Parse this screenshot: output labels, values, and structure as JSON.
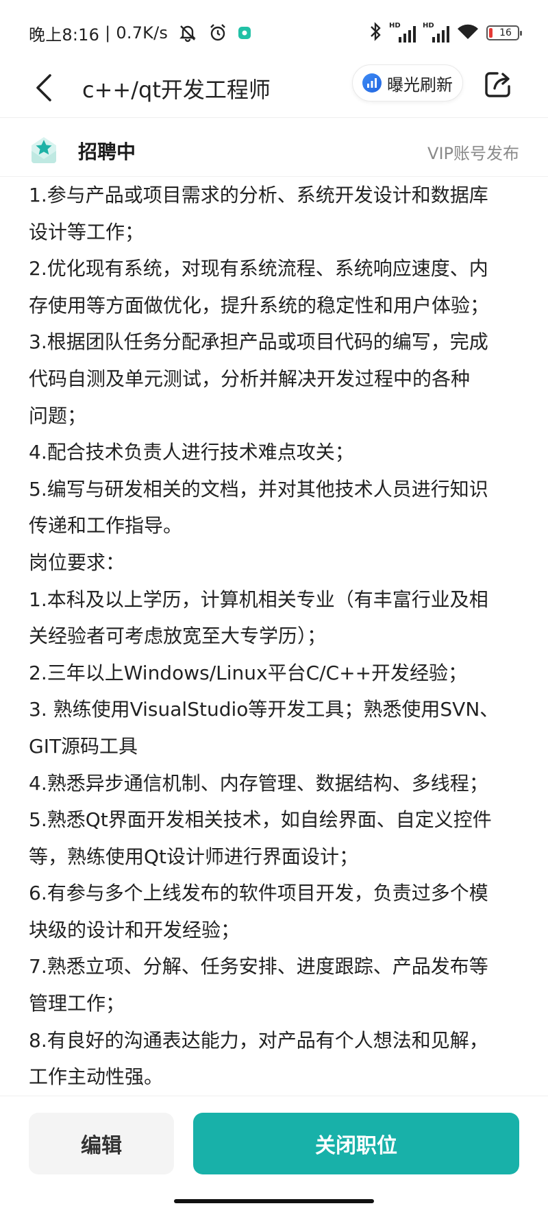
{
  "status_bar": {
    "time": "晚上8:16",
    "net_speed": "0.7K/s",
    "battery_level": "16",
    "icons": [
      "mute-bell-icon",
      "alarm-icon",
      "app-notification-icon",
      "bluetooth-icon",
      "hd-signal-icon",
      "hd-signal-icon",
      "wifi-icon",
      "battery-icon"
    ]
  },
  "header": {
    "title": "c++/qt开发工程师",
    "refresh_label": "曝光刷新"
  },
  "job_status": {
    "label": "招聘中",
    "publish_note": "VIP账号发布"
  },
  "description": {
    "lines": [
      "1.参与产品或项目需求的分析、系统开发设计和数据库",
      "设计等工作；",
      "2.优化现有系统，对现有系统流程、系统响应速度、内",
      "存使用等方面做优化，提升系统的稳定性和用户体验；",
      "3.根据团队任务分配承担产品或项目代码的编写，完成",
      "代码自测及单元测试，分析并解决开发过程中的各种",
      "问题；",
      "4.配合技术负责人进行技术难点攻关；",
      "5.编写与研发相关的文档，并对其他技术人员进行知识",
      "传递和工作指导。",
      "岗位要求：",
      "1.本科及以上学历，计算机相关专业（有丰富行业及相",
      "关经验者可考虑放宽至大专学历）；",
      "2.三年以上Windows/Linux平台C/C++开发经验；",
      "3. 熟练使用VisualStudio等开发工具；熟悉使用SVN、",
      "GIT源码工具",
      "4.熟悉异步通信机制、内存管理、数据结构、多线程；",
      "5.熟悉Qt界面开发相关技术，如自绘界面、自定义控件",
      "等，熟练使用Qt设计师进行界面设计；",
      "6.有参与多个上线发布的软件项目开发，负责过多个模",
      "块级的设计和开发经验；",
      "7.熟悉立项、分解、任务安排、进度跟踪、产品发布等",
      "管理工作；",
      "8.有良好的沟通表达能力，对产品有个人想法和见解，",
      "工作主动性强。"
    ]
  },
  "actions": {
    "edit_label": "编辑",
    "close_label": "关闭职位"
  },
  "colors": {
    "accent": "#18b1a9",
    "refresh_icon": "#2f7cf0",
    "battery_low": "#e53935",
    "muted_text": "#8a8a8a"
  }
}
